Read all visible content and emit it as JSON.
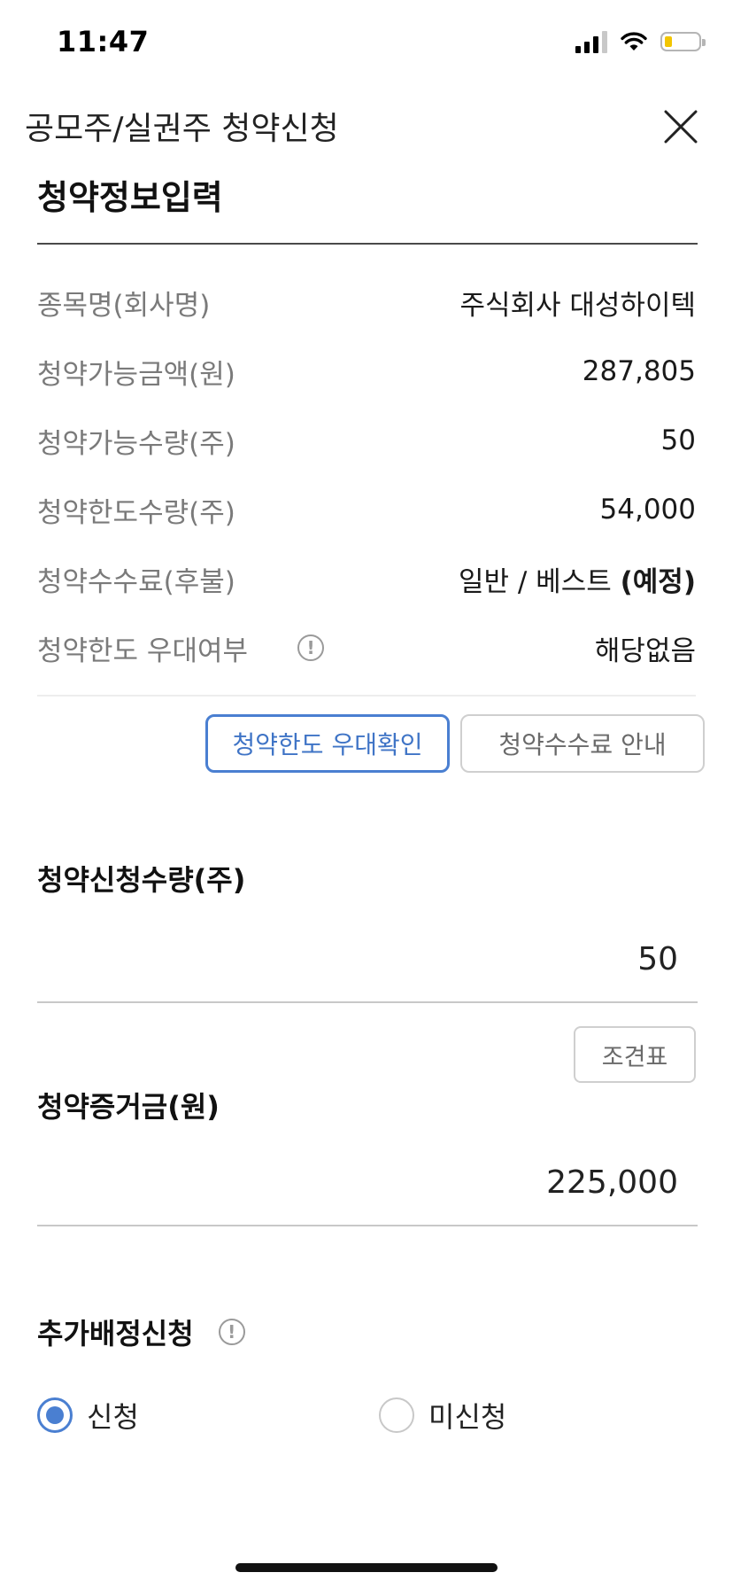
{
  "status_bar": {
    "time": "11:47"
  },
  "header": {
    "title": "공모주/실권주 청약신청"
  },
  "section": {
    "title": "청약정보입력"
  },
  "info_rows": [
    {
      "label": "종목명(회사명)",
      "value": "주식회사 대성하이텍"
    },
    {
      "label": "청약가능금액(원)",
      "value": "287,805"
    },
    {
      "label": "청약가능수량(주)",
      "value": "50"
    },
    {
      "label": "청약한도수량(주)",
      "value": "54,000"
    },
    {
      "label": "청약수수료(후불)",
      "value": "일반 / 베스트",
      "value_suffix": "(예정)"
    },
    {
      "label": "청약한도 우대여부",
      "value": "해당없음",
      "icon": "info-circle-icon"
    }
  ],
  "buttons": {
    "limit_check": "청약한도 우대확인",
    "fee_guide": "청약수수료 안내",
    "condition_table": "조견표"
  },
  "quantity_field": {
    "label": "청약신청수량(주)",
    "value": "50"
  },
  "deposit_field": {
    "label": "청약증거금(원)",
    "value": "225,000"
  },
  "extra_allocation": {
    "title": "추가배정신청",
    "icon": "info-circle-icon",
    "options": [
      {
        "label": "신청",
        "selected": true
      },
      {
        "label": "미신청",
        "selected": false
      }
    ]
  },
  "colors": {
    "accent": "#4a7fd1",
    "label_gray": "#7a7a7a",
    "border_gray": "#cfcfcf",
    "battery": "#f2c500"
  },
  "battery_level": 0.22
}
